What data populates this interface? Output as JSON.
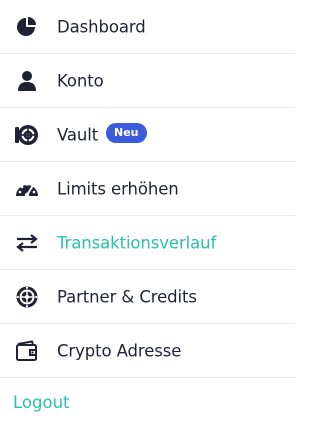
{
  "menu": {
    "items": [
      {
        "label": "Dashboard",
        "icon": "pie-chart-icon"
      },
      {
        "label": "Konto",
        "icon": "user-icon"
      },
      {
        "label": "Vault",
        "icon": "vault-icon",
        "badge": "Neu"
      },
      {
        "label": "Limits erhöhen",
        "icon": "speedometer-icon"
      },
      {
        "label": "Transaktionsverlauf",
        "icon": "exchange-arrows-icon",
        "active": true
      },
      {
        "label": "Partner & Credits",
        "icon": "globe-icon"
      },
      {
        "label": "Crypto Adresse",
        "icon": "wallet-icon"
      }
    ],
    "logout_label": "Logout"
  },
  "colors": {
    "text": "#1f2235",
    "accent": "#27c2a8",
    "badge": "#3b5bdb",
    "divider": "#e8e8e8"
  }
}
